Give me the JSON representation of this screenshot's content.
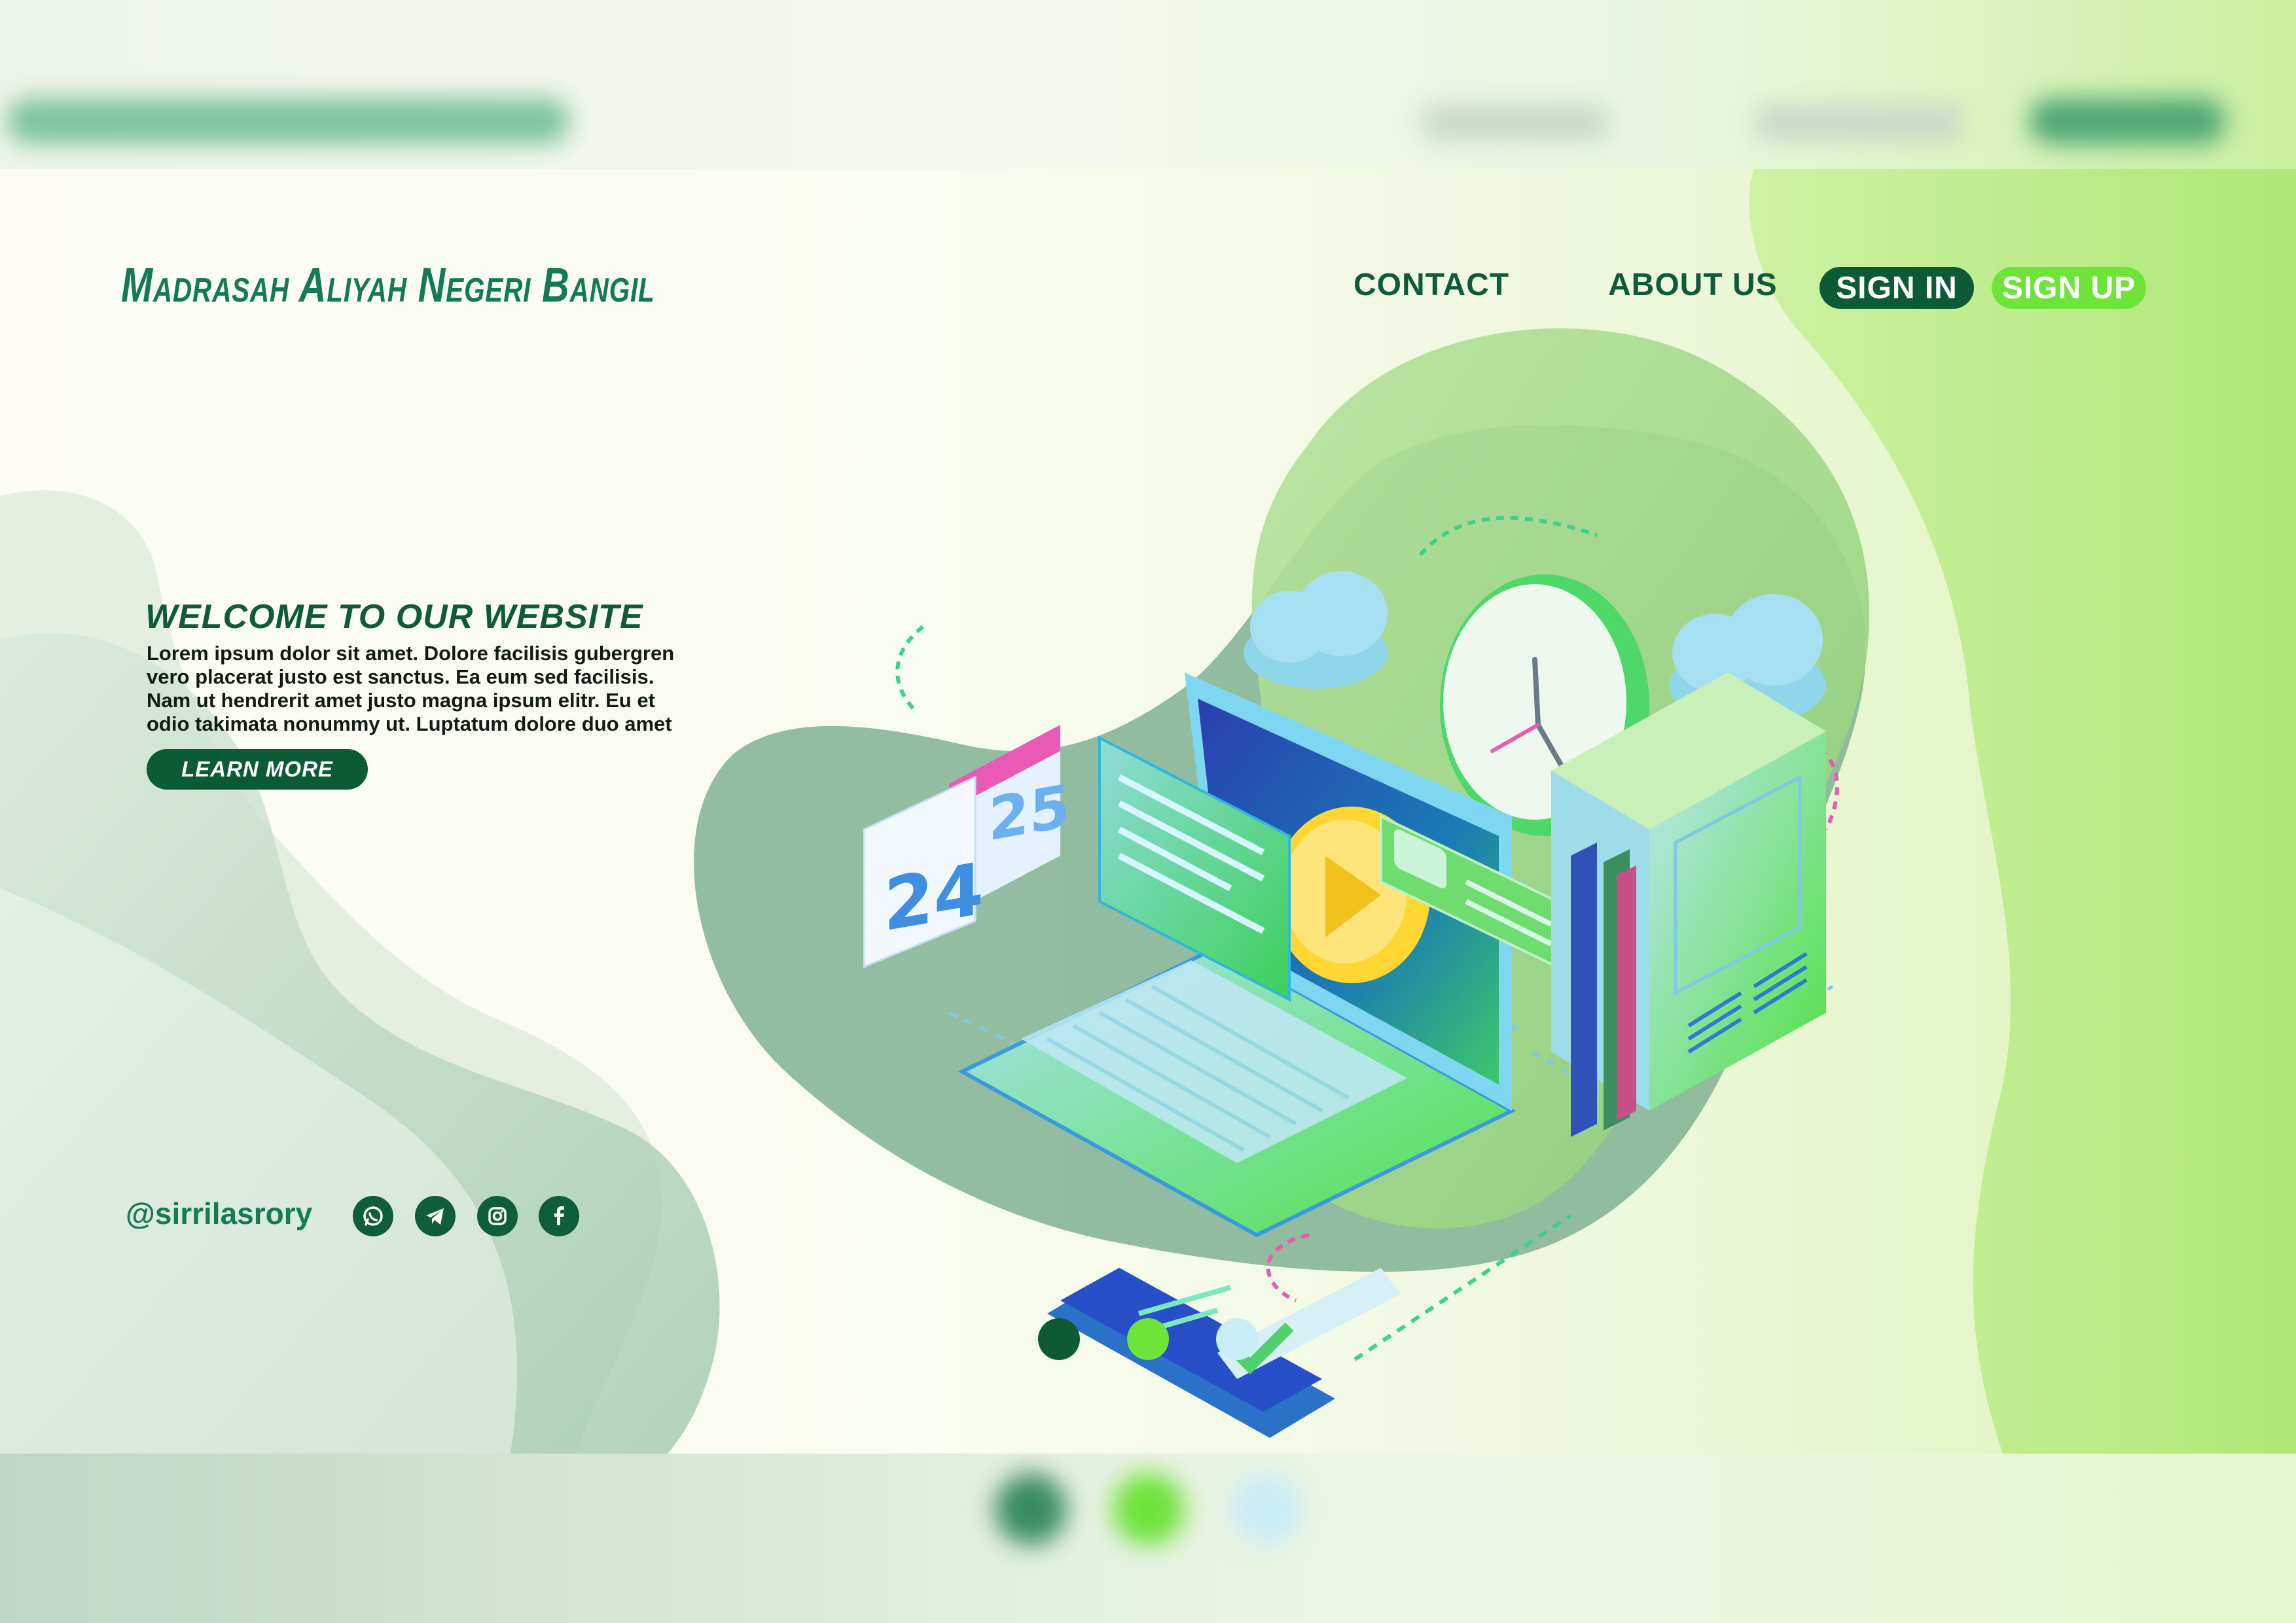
{
  "site": {
    "title": "Madrasah Aliyah Negeri Bangil"
  },
  "nav": {
    "contact": "CONTACT",
    "about": "ABOUT US",
    "sign_in": "SIGN IN",
    "sign_up": "SIGN UP"
  },
  "hero": {
    "title": "WELCOME TO OUR WEBSITE",
    "body": "Lorem ipsum dolor sit amet. Dolore facilisis gubergren vero placerat justo est sanctus. Ea eum sed facilisis. Nam ut hendrerit amet justo magna ipsum elitr. Eu et odio takimata nonummy ut. Luptatum dolore duo amet",
    "cta": "LEARN MORE"
  },
  "footer": {
    "handle": "@sirrilasrory",
    "social_icons": [
      "whatsapp-icon",
      "telegram-icon",
      "instagram-icon",
      "facebook-icon"
    ]
  },
  "illustration": {
    "calendar_front": "24",
    "calendar_back": "25"
  },
  "carousel": {
    "slides": 3,
    "active_index": 0
  },
  "colors": {
    "dark_green": "#0d5a36",
    "bright_green": "#6ee33a",
    "accent_text": "#137a57",
    "light_blue": "#c9ecf6"
  }
}
